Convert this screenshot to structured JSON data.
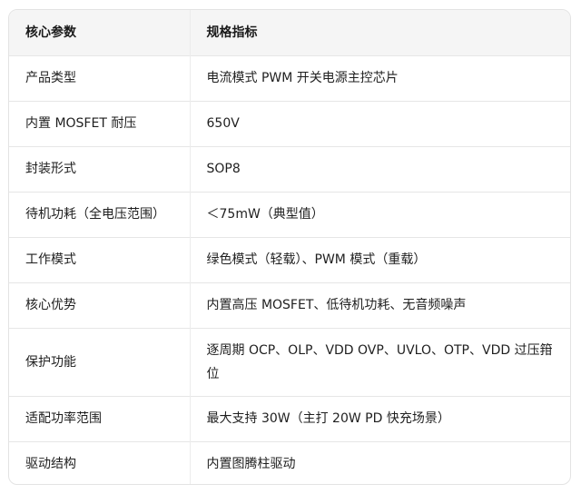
{
  "table": {
    "headers": [
      "核心参数",
      "规格指标"
    ],
    "rows": [
      [
        "产品类型",
        "电流模式 PWM 开关电源主控芯片"
      ],
      [
        "内置 MOSFET 耐压",
        "650V"
      ],
      [
        "封装形式",
        "SOP8"
      ],
      [
        "待机功耗（全电压范围）",
        "＜75mW（典型值）"
      ],
      [
        "工作模式",
        "绿色模式（轻载）、PWM 模式（重载）"
      ],
      [
        "核心优势",
        "内置高压 MOSFET、低待机功耗、无音频噪声"
      ],
      [
        "保护功能",
        "逐周期 OCP、OLP、VDD OVP、UVLO、OTP、VDD 过压箝位"
      ],
      [
        "适配功率范围",
        "最大支持 30W（主打 20W PD 快充场景）"
      ],
      [
        "驱动结构",
        "内置图腾柱驱动"
      ]
    ]
  }
}
